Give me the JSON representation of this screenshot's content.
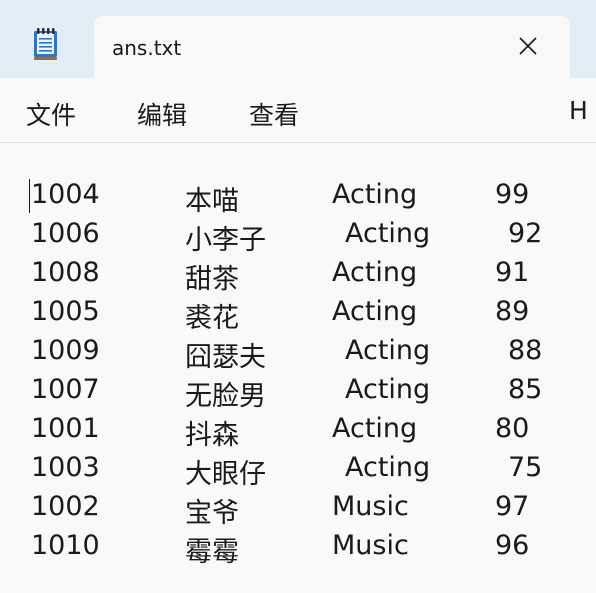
{
  "tab": {
    "title": "ans.txt"
  },
  "menu": [
    {
      "label": "文件"
    },
    {
      "label": "编辑"
    },
    {
      "label": "查看"
    },
    {
      "label": "H"
    }
  ],
  "lines": [
    {
      "id": "1004",
      "name": "本喵",
      "category": "Acting",
      "score": "99"
    },
    {
      "id": "1006",
      "name": "小李子",
      "category": "Acting",
      "score": "92"
    },
    {
      "id": "1008",
      "name": "甜茶",
      "category": "Acting",
      "score": "91"
    },
    {
      "id": "1005",
      "name": "裘花",
      "category": "Acting",
      "score": "89"
    },
    {
      "id": "1009",
      "name": "囧瑟夫",
      "category": "Acting",
      "score": "88"
    },
    {
      "id": "1007",
      "name": "无脸男",
      "category": "Acting",
      "score": "85"
    },
    {
      "id": "1001",
      "name": "抖森",
      "category": "Acting",
      "score": "80"
    },
    {
      "id": "1003",
      "name": "大眼仔",
      "category": "Acting",
      "score": "75"
    },
    {
      "id": "1002",
      "name": "宝爷",
      "category": "Music",
      "score": "97"
    },
    {
      "id": "1010",
      "name": "霉霉",
      "category": "Music",
      "score": "96"
    }
  ],
  "colors": {
    "titlebar": "#e2eef5",
    "surface": "#f9f9f9",
    "text": "#1a1a1a"
  },
  "icons": {
    "app": "notepad-icon",
    "close": "close-icon"
  }
}
